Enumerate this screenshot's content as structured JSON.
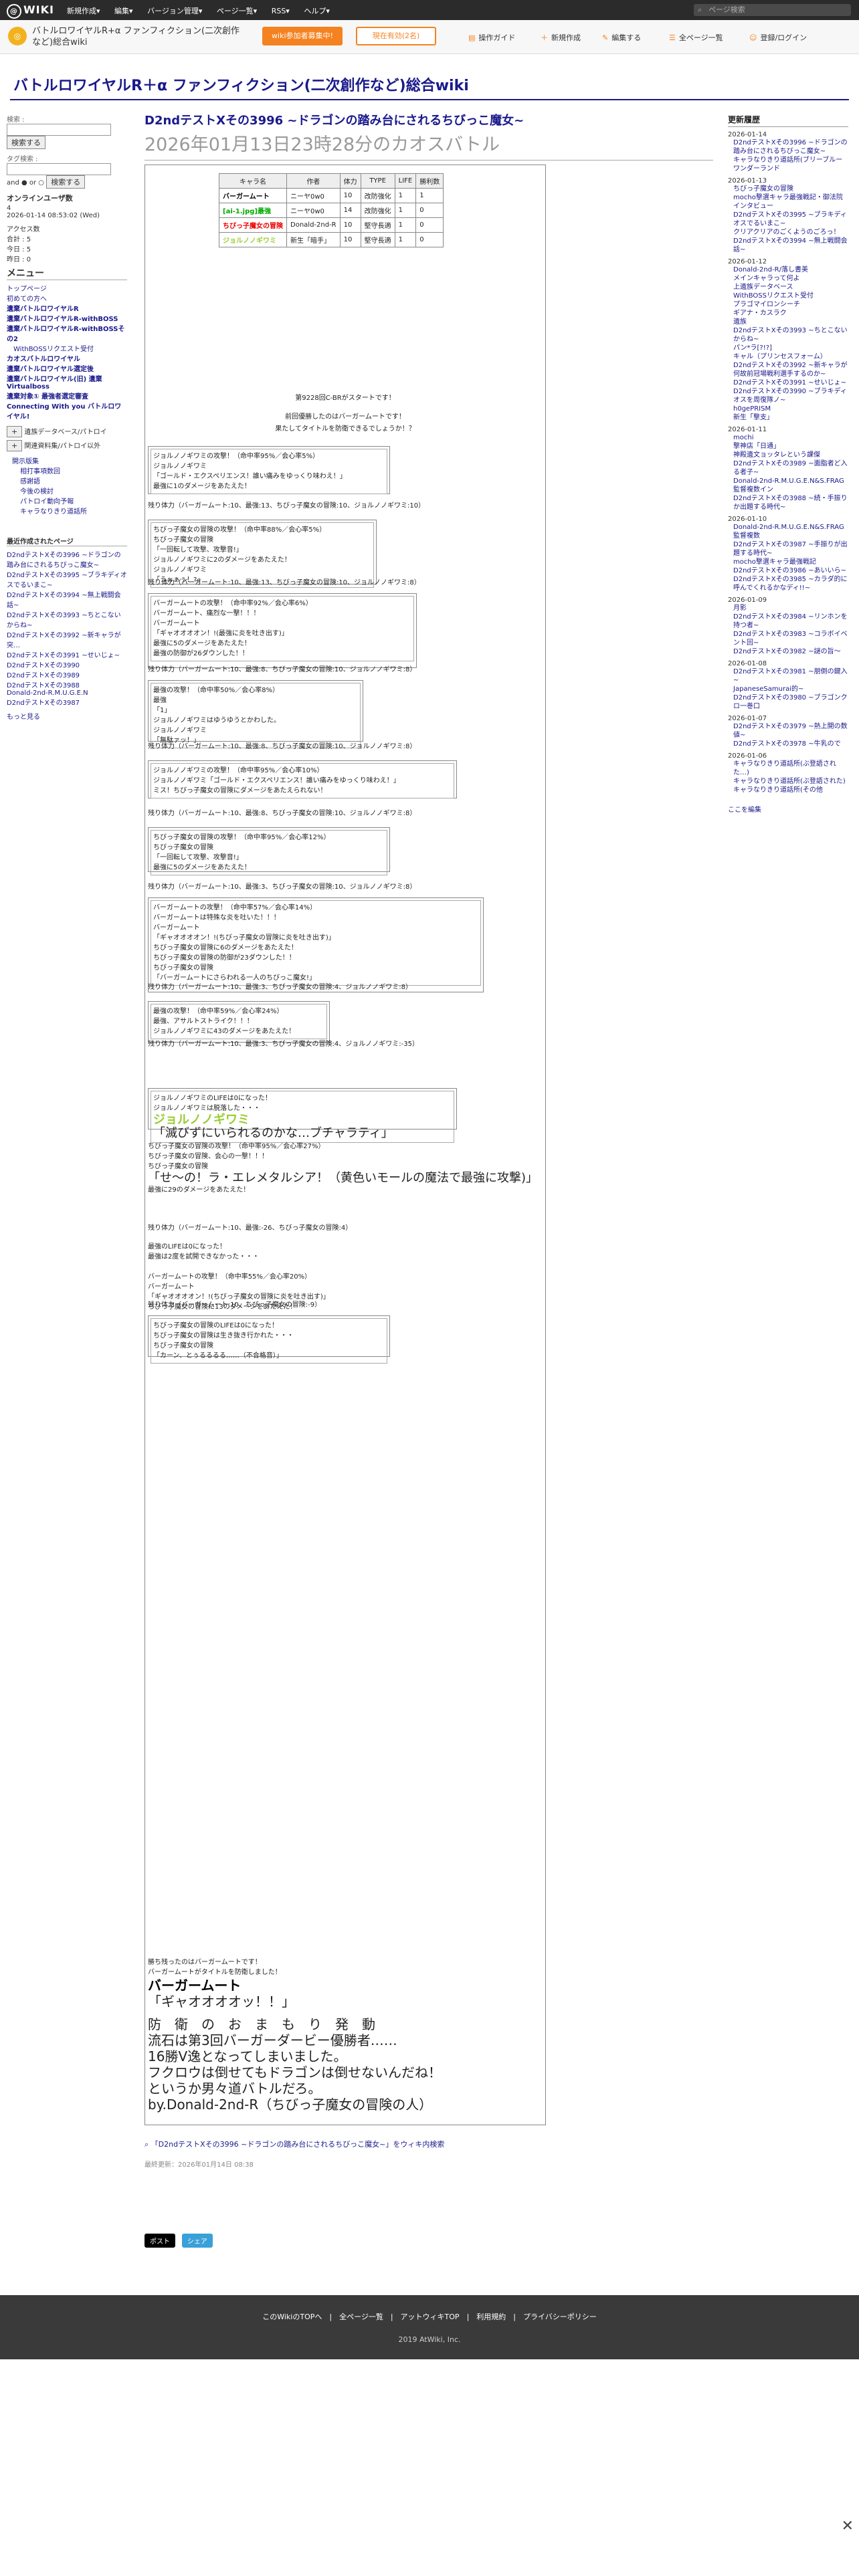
{
  "topbar": {
    "logo": "WIKI",
    "menu": [
      "新規作成▾",
      "編集▾",
      "バージョン管理▾",
      "ページ一覧▾",
      "RSS▾",
      "ヘルプ▾"
    ],
    "search_placeholder": "ページ検索"
  },
  "header": {
    "site_name": "バトルロワイヤルR+α ファンフィクション(二次創作など)総合wiki",
    "join": "wiki参加者募集中!",
    "member": "現在有効(2名)",
    "nav": [
      "操作ガイド",
      "新規作成",
      "編集する",
      "全ページ一覧",
      "登録/ログイン"
    ]
  },
  "site_title": "バトルロワイヤルR＋α ファンフィクション(二次創作など)総合wiki",
  "left": {
    "search_label": "検索 :",
    "search_btn": "検索する",
    "search_btn2": "検索する",
    "tag_label": "タグ検索 :",
    "and_or": "and ● or ○",
    "online_label": "オンラインユーザ数",
    "online_val": "4",
    "date": "2026-01-14 08:53:02 (Wed)",
    "access_label": "アクセス数",
    "access_total": "合計 : 5",
    "access_today": "今日 : 5",
    "access_yest": "昨日 : 0",
    "menu_title": "メニュー",
    "menu_items": [
      "トップページ",
      "初めての方へ",
      "遺棄バトルロワイヤルR",
      "遺棄バトルロワイヤルR-withBOSS",
      "遺棄バトルロワイヤルR-withBOSSその2",
      "WithBOSSリクエスト受付",
      "カオスバトルロワイヤル",
      "遺棄バトルロワイヤル選定後",
      "遺棄バトルロワイヤル(旧) 遺棄Virtualboss",
      "遺棄対象① 最強者選定審査",
      "Connecting With you バトルロワイヤル!"
    ],
    "boxes": [
      "遺族データベース/パトロイ",
      "関連資料集/パトロイ以外"
    ],
    "sub_items": [
      "開示版集",
      "相打事項数回",
      "感謝語",
      "今後の検討",
      "パトロイ動向予報",
      "キャラなりきり道話所"
    ],
    "recent_title": "最近作成されたページ",
    "recent": [
      "D2ndテストXその3996 ~ドラゴンの踏み台にされるちびっこ魔女~",
      "D2ndテストXその3995 ~ブラキディオスでるいまこ~",
      "D2ndテストXその3994 ~無上戦闘会話~",
      "D2ndテストXその3993 ~ちとこないからね~",
      "D2ndテストXその3992 ~新キャラが突…",
      "D2ndテストXその3991 ~せいじょ~",
      "D2ndテストXその3990",
      "D2ndテストXその3989",
      "D2ndテストXその3988",
      "Donald-2nd-R.M.U.G.E.N",
      "D2ndテストXその3987"
    ],
    "more": "もっと見る"
  },
  "page": {
    "title": "D2ndテストXその3996 ~ドラゴンの踏み台にされるちびっこ魔女~",
    "subtitle": "2026年01月13日23時28分のカオスバトル"
  },
  "roster": {
    "headers": [
      "キャラ名",
      "作者",
      "体力",
      "TYPE",
      "LIFE",
      "勝利数"
    ],
    "rows": [
      [
        "バーガームート",
        "ニーヤ0w0",
        "10",
        "改防強化",
        "1",
        "1"
      ],
      [
        "[ai-1.jpg]最強",
        "ニーヤ0w0",
        "14",
        "改防強化",
        "1",
        "0"
      ],
      [
        "ちびっ子魔女の冒険",
        "Donald-2nd-R",
        "10",
        "堅守長適",
        "1",
        "0"
      ],
      [
        "ジョルノノギワミ",
        "新生「暗手」",
        "10",
        "堅守長適",
        "1",
        "0"
      ]
    ]
  },
  "intro": [
    "第9228回C-BRがスタートです！",
    "前回優勝したのはバーガームートです！",
    "果たしてタイトルを防衛できるでしょうか！？"
  ],
  "log": [
    {
      "lines": [
        "ジョルノノギワミの攻撃！（命中率95%／会心率5%）",
        "ジョルノノギワミ",
        "「ゴールド・エクスペリエンス！誰い痛みをゆっくり味わえ！」",
        "最強に1のダメージをあたえた！"
      ]
    },
    {
      "remain": "残り体力（バーガームート:10、最強:13、ちびっ子魔女の冒険:10、ジョルノノギワミ:10）"
    },
    {
      "lines": [
        "ちびっ子魔女の冒険の攻撃！（命中率88%／会心率5%）",
        "ちびっ子魔女の冒険",
        "「一回転して攻撃、攻撃音!」",
        "ジョルノノギワミに2のダメージをあたえた！",
        "ジョルノノギワミ",
        "「うぉぁぅ！?」"
      ]
    },
    {
      "remain": "残り体力（バーガームート:10、最強:13、ちびっ子魔女の冒険:10、ジョルノノギワミ:8）"
    },
    {
      "lines": [
        "バーガームートの攻撃！（命中率92%／会心率6%）",
        "バーガームート、痛烈な一撃！！！",
        "バーガームート",
        "「ギャオオオオン！!(最強に炎を吐き出す)」",
        "最強に5のダメージをあたえた！",
        "最強の防御が26ダウンした！！"
      ]
    },
    {
      "remain": "残り体力（バーガームート:10、最強:8、ちびっ子魔女の冒険:10、ジョルノノギワミ:8）"
    },
    {
      "lines": [
        "最強の攻撃！（命中率50%／会心率8%）",
        "最強",
        "「1」",
        "ジョルノノギワミはゆうゆうとかわした。",
        "ジョルノノギワミ",
        "「無駄ァッ！」"
      ]
    },
    {
      "remain": "残り体力（バーガームート:10、最強:8、ちびっ子魔女の冒険:10、ジョルノノギワミ:8）"
    },
    {
      "lines": [
        "ジョルノノギワミの攻撃！（命中率95%／会心率10%）",
        "ジョルノノギワミ「ゴールド・エクスペリエンス！誰い痛みをゆっくり味わえ！」",
        "ミス！ちびっ子魔女の冒険にダメージをあたえられない！"
      ]
    },
    {
      "remain": "残り体力（バーガームート:10、最強:8、ちびっ子魔女の冒険:10、ジョルノノギワミ:8）"
    },
    {
      "lines": [
        "ちびっ子魔女の冒険の攻撃！（命中率95%／会心率12%）",
        "ちびっ子魔女の冒険",
        "「一回転して攻撃、攻撃音!」",
        "最強に5のダメージをあたえた！"
      ]
    },
    {
      "remain": "残り体力（バーガームート:10、最強:3、ちびっ子魔女の冒険:10、ジョルノノギワミ:8）"
    },
    {
      "lines": [
        "バーガームートの攻撃！（命中率57%／会心率14%）",
        "バーガームートは特殊な炎を吐いた！！！",
        "バーガームート",
        "「ギャオオオオン！!(ちびっ子魔女の冒険に炎を吐き出す)」",
        "ちびっ子魔女の冒険に6のダメージをあたえた！",
        "ちびっ子魔女の冒険の防御が23ダウンした！！",
        "ちびっ子魔女の冒険",
        "「バーガームートにさらわれる一人のちびっこ魔女!」"
      ]
    },
    {
      "remain": "残り体力（バーガームート:10、最強:3、ちびっ子魔女の冒険:4、ジョルノノギワミ:8）"
    },
    {
      "lines": [
        "最強の攻撃！（命中率59%／会心率24%）",
        "最強、アサルトストライク！！！",
        "ジョルノノギワミに43のダメージをあたえた！"
      ]
    },
    {
      "remain": "残り体力（バーガームート:10、最強:3、ちびっ子魔女の冒険:4、ジョルノノギワミ:-35）"
    },
    {
      "lines": [
        "ジョルノノギワミのLIFEは0になった！",
        "ジョルノノギワミは脱落した・・・",
        "ジョルノノギワミ",
        "「滅びずにいられるのかな…ブチャラティ」"
      ]
    },
    {
      "lines": [
        "ちびっ子魔女の冒険の攻撃！（命中率95%／会心率27%）",
        "ちびっ子魔女の冒険、会心の一撃！！！",
        "ちびっ子魔女の冒険",
        "「せ〜の！ラ・エレメタルシア！（黄色いモールの魔法で最強に攻撃)」",
        "最強に29のダメージをあたえた！"
      ]
    },
    {
      "remain": "残り体力（バーガームート:10、最強:-26、ちびっ子魔女の冒険:4）"
    },
    {
      "lines": [
        "最強のLIFEは0になった！",
        "最強は2度を試開できなかった・・・"
      ]
    },
    {
      "lines": [
        "バーガームートの攻撃！（命中率55%／会心率20%）",
        "バーガームート",
        "「ギャオオオオン！!(ちびっ子魔女の冒険に炎を吐き出す)」",
        "ちびっ子魔女の冒険に13のダメージをあたえた！"
      ]
    },
    {
      "remain": "残り体力（バーガームート:10、ちびっ子魔女の冒険:-9）"
    },
    {
      "lines": [
        "ちびっ子魔女の冒険のLIFEは0になった！",
        "ちびっ子魔女の冒険は生き抜き行かれた・・・",
        "ちびっ子魔女の冒険",
        "「カーン、とぅるるるる……（不合格音）」"
      ]
    }
  ],
  "result": {
    "lines": [
      "勝ち残ったのはバーガームートです！",
      "バーガームートがタイトルを防衛しました！"
    ],
    "name": "バーガームート",
    "quote": "「ギャオオオオッ！！」",
    "big": [
      "防　衛　の　お　ま　も　り　発　動",
      "流石は第3回バーガーダービー優勝者……",
      "16勝V逸となってしまいました。",
      "フクロウは倒せてもドラゴンは倒せないんだね！",
      "というか男々道バトルだろ。",
      "by.Donald-2nd-R（ちびっ子魔女の冒険の人）"
    ]
  },
  "after": {
    "wiki_link": "「D2ndテストXその3996 ~ドラゴンの踏み台にされるちびっこ魔女~」をウィキ内検索",
    "updated": "最終更新：2026年01月14日 08:38"
  },
  "share": {
    "post": "ポスト",
    "share": "シェア"
  },
  "right": {
    "title": "更新履歴",
    "groups": [
      {
        "date": "2026-01-14",
        "items": [
          "D2ndテストXその3996 ~ドラゴンの踏み台にされるちびっこ魔女~",
          "キャラなりきり道話所(ブリーブルーワンダーランド"
        ]
      },
      {
        "date": "2026-01-13",
        "items": [
          "ちびっ子魔女の冒険",
          "mocho撃選キャラ最強戦記・御法院インタビュー",
          "D2ndテストXその3995 ~ブラキディオスでるいまこ~",
          "クリアクリアのごくようのごろっ！",
          "D2ndテストXその3994 ~無上戦闘会話~"
        ]
      },
      {
        "date": "2026-01-12",
        "items": [
          "Donald-2nd-R/落し書美",
          "メインキャラって何よ",
          "上遺族データベース",
          "WithBOSSリクエスト受付",
          "プラゴマイロンシーチ",
          "ギアナ・カスラク",
          "遺族",
          "D2ndテストXその3993 ~ちとこないからね~",
          "パン*ラ[?!?]",
          "キャル（プリンセスフォーム）",
          "D2ndテストXその3992 ~新キャラが何故前冠場戦利選手するのか~",
          "D2ndテストXその3991 ~せいじょ~",
          "D2ndテストXその3990 ~ブラキディオスを周復隊ノ~",
          "h0gePRISM",
          "新生「撃支」"
        ]
      },
      {
        "date": "2026-01-11",
        "items": [
          "mochi",
          "撃神店「日通」",
          "神殿遺文ョッタレという課傑",
          "D2ndテストXその3989 ~面脂者ど入る者子~",
          "Donald-2nd-R.M.U.G.E.N&S.FRAG 監督複数イン",
          "D2ndテストXその3988 ~続・手振りか出題する時代~"
        ]
      },
      {
        "date": "2026-01-10",
        "items": [
          "Donald-2nd-R.M.U.G.E.N&S.FRAG 監督複数",
          "D2ndテストXその3987 ~手振りが出題する時代~",
          "mocho撃選キャラ最強戦記",
          "D2ndテストXその3986 ~あいいら~",
          "D2ndテストXその3985 ~カラダ的に呼んでくれるかなディ!!~"
        ]
      },
      {
        "date": "2026-01-09",
        "items": [
          "月影",
          "D2ndテストXその3984 ~リンホンを持つ者~",
          "D2ndテストXその3983 ~コラボイベント回~",
          "D2ndテストXその3982 ~謎の旨～"
        ]
      },
      {
        "date": "2026-01-08",
        "items": [
          "D2ndテストXその3981 ~朋倒の鍵入~",
          "JapaneseSamurai的~",
          "D2ndテストXその3980 ~ブラゴンクロ一巻口"
        ]
      },
      {
        "date": "2026-01-07",
        "items": [
          "D2ndテストXその3979 ~熱上開の数値~",
          "D2ndテストXその3978 ~牛乳ので"
        ]
      },
      {
        "date": "2026-01-06",
        "items": [
          "キャラなりきり道話所(ぶ登語された…)",
          "キャラなりきり道話所(ぶ登語された)",
          "キャラなりきり道話所(その他"
        ]
      }
    ],
    "edit": "ここを編集"
  },
  "footer": {
    "links": "このWikiのTOPへ　|　全ページ一覧　|　アットウィキTOP　|　利用規約　|　プライバシーポリシー",
    "copy": "2019 AtWiki, Inc."
  }
}
